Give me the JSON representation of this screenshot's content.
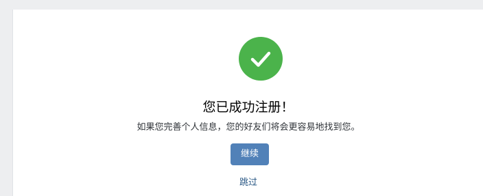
{
  "colors": {
    "accent_green": "#4bb34b",
    "button_blue": "#5181b8",
    "link_blue": "#2a5885",
    "page_bg": "#edeef0"
  },
  "success": {
    "icon": "checkmark-circle-icon",
    "title": "您已成功注册！",
    "message": "如果您完善个人信息，您的好友们将会更容易地找到您。"
  },
  "actions": {
    "continue_label": "继续",
    "skip_label": "跳过"
  }
}
